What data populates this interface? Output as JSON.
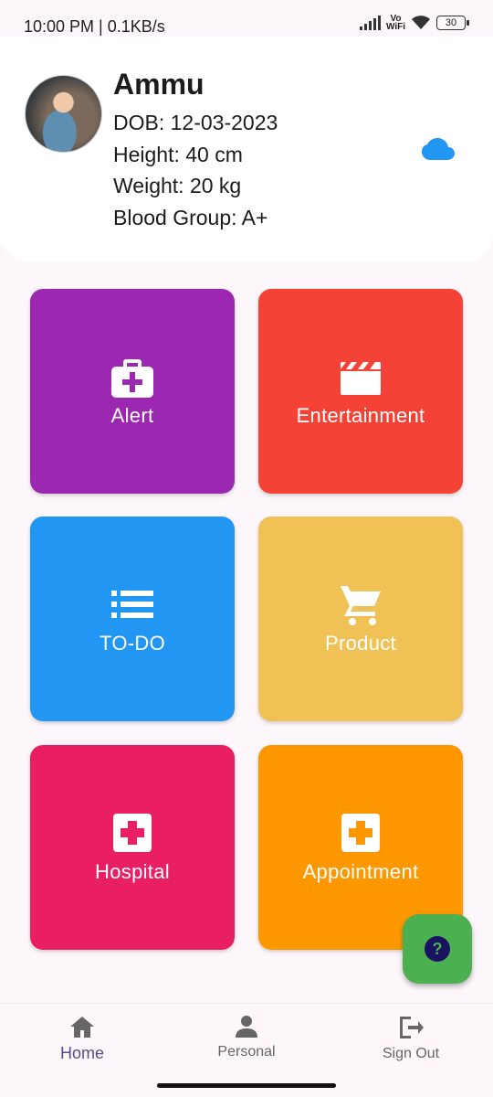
{
  "status_bar": {
    "time": "10:00 PM | 0.1KB/s",
    "network": "Vo\nWiFi",
    "battery": "30"
  },
  "profile": {
    "name": "Ammu",
    "dob": "DOB: 12-03-2023",
    "height": "Height: 40 cm",
    "weight": "Weight: 20 kg",
    "blood_group": "Blood Group: A+"
  },
  "tiles": [
    {
      "label": "Alert",
      "color": "#9c27b0",
      "icon": "medical-bag-icon"
    },
    {
      "label": "Entertainment",
      "color": "#f44336",
      "icon": "clapperboard-icon"
    },
    {
      "label": "TO-DO",
      "color": "#2196f3",
      "icon": "list-icon"
    },
    {
      "label": "Product",
      "color": "#f2c14e",
      "icon": "cart-icon"
    },
    {
      "label": "Hospital",
      "color": "#e91e63",
      "icon": "hospital-cross-icon"
    },
    {
      "label": "Appointment",
      "color": "#ff9800",
      "icon": "hospital-cross-icon"
    }
  ],
  "fab": {
    "icon": "help-icon",
    "color": "#4caf50"
  },
  "bottom_nav": {
    "items": [
      {
        "label": "Home",
        "icon": "home-icon",
        "active": true
      },
      {
        "label": "Personal",
        "icon": "person-icon",
        "active": false
      },
      {
        "label": "Sign Out",
        "icon": "logout-icon",
        "active": false
      }
    ]
  },
  "colors": {
    "accent": "#5c4a8a",
    "cloud": "#2196f3"
  }
}
